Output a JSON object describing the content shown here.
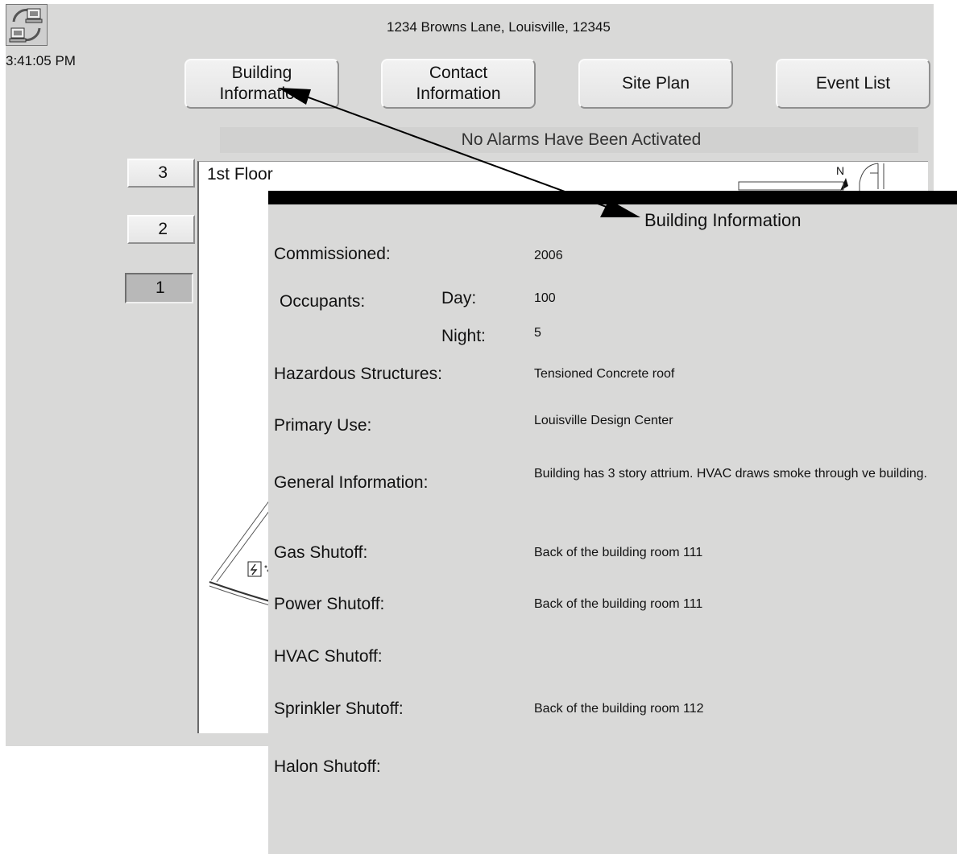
{
  "header": {
    "clock": "3:41:05 PM",
    "address": "1234 Browns Lane, Louisville, 12345",
    "app_icon": "network-computers-icon"
  },
  "nav": {
    "building_info": "Building\nInformation",
    "contact_info": "Contact\nInformation",
    "site_plan": "Site Plan",
    "event_list": "Event List"
  },
  "alarm_status": "No Alarms Have Been Activated",
  "floors": {
    "buttons": [
      "3",
      "2",
      "1"
    ],
    "active": "1",
    "current_label": "1st Floor",
    "compass_letter": "N"
  },
  "building_info_panel": {
    "title": "Building Information",
    "commissioned_label": "Commissioned:",
    "commissioned_value": "2006",
    "occupants_label": "Occupants:",
    "day_label": "Day:",
    "day_value": "100",
    "night_label": "Night:",
    "night_value": "5",
    "hazardous_label": "Hazardous Structures:",
    "hazardous_value": "Tensioned Concrete roof",
    "primary_use_label": "Primary Use:",
    "primary_use_value": "Louisville Design Center",
    "general_info_label": "General Information:",
    "general_info_value": "Building has 3 story attrium. HVAC draws smoke through ve building.",
    "gas_label": "Gas Shutoff:",
    "gas_value": "Back of the building room 111",
    "power_label": "Power Shutoff:",
    "power_value": "Back of the building room 111",
    "hvac_label": "HVAC Shutoff:",
    "hvac_value": "",
    "sprinkler_label": "Sprinkler Shutoff:",
    "sprinkler_value": "Back of the building room 112",
    "halon_label": "Halon Shutoff:",
    "halon_value": ""
  },
  "colors": {
    "panel_bg": "#d9d9d8",
    "title_bar": "#000000",
    "alarm_bar": "#d1d1d0"
  }
}
